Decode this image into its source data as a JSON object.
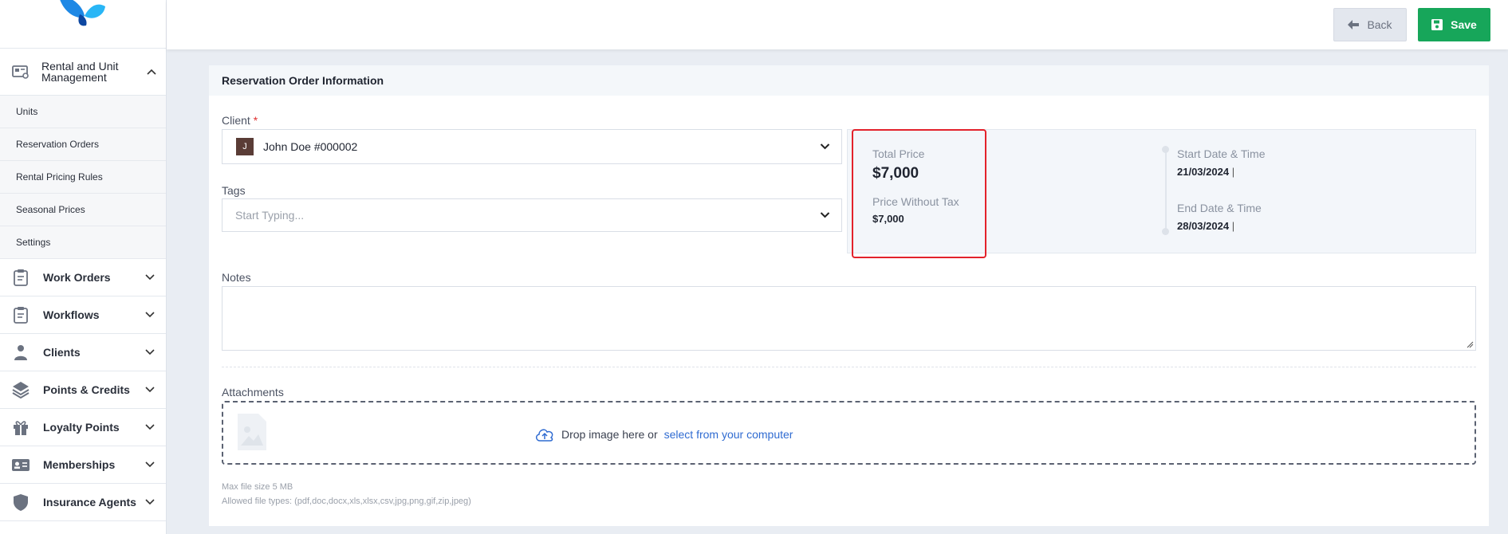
{
  "sidebar": {
    "group": {
      "label": "Rental and Unit Management"
    },
    "sub_items": [
      {
        "label": "Units"
      },
      {
        "label": "Reservation Orders"
      },
      {
        "label": "Rental Pricing Rules"
      },
      {
        "label": "Seasonal Prices"
      },
      {
        "label": "Settings"
      }
    ],
    "nav_items": [
      {
        "label": "Work Orders",
        "icon": "clipboard-icon"
      },
      {
        "label": "Workflows",
        "icon": "clipboard-icon"
      },
      {
        "label": "Clients",
        "icon": "user-icon"
      },
      {
        "label": "Points & Credits",
        "icon": "layers-icon"
      },
      {
        "label": "Loyalty Points",
        "icon": "gift-icon"
      },
      {
        "label": "Memberships",
        "icon": "id-card-icon"
      },
      {
        "label": "Insurance Agents",
        "icon": "shield-icon"
      }
    ]
  },
  "toolbar": {
    "back_label": "Back",
    "save_label": "Save"
  },
  "form": {
    "section_title": "Reservation Order Information",
    "client": {
      "label": "Client",
      "required_mark": "*",
      "avatar_letter": "J",
      "value": "John Doe #000002"
    },
    "tags": {
      "label": "Tags",
      "placeholder": "Start Typing..."
    },
    "summary": {
      "total_price_label": "Total Price",
      "total_price": "$7,000",
      "price_without_tax_label": "Price Without Tax",
      "price_without_tax": "$7,000",
      "start_label": "Start Date & Time",
      "start_value": "21/03/2024",
      "end_label": "End Date & Time",
      "end_value": "28/03/2024",
      "separator": "|"
    },
    "notes": {
      "label": "Notes"
    },
    "attachments": {
      "label": "Attachments",
      "drop_text": "Drop image here or",
      "drop_link": "select from your computer",
      "max_size": "Max file size 5 MB",
      "allowed_types": "Allowed file types: (pdf,doc,docx,xls,xlsx,csv,jpg,png,gif,zip,jpeg)"
    }
  },
  "colors": {
    "accent_green": "#17a65a",
    "link_blue": "#2f6bd1",
    "highlight_red": "#e3222b"
  }
}
